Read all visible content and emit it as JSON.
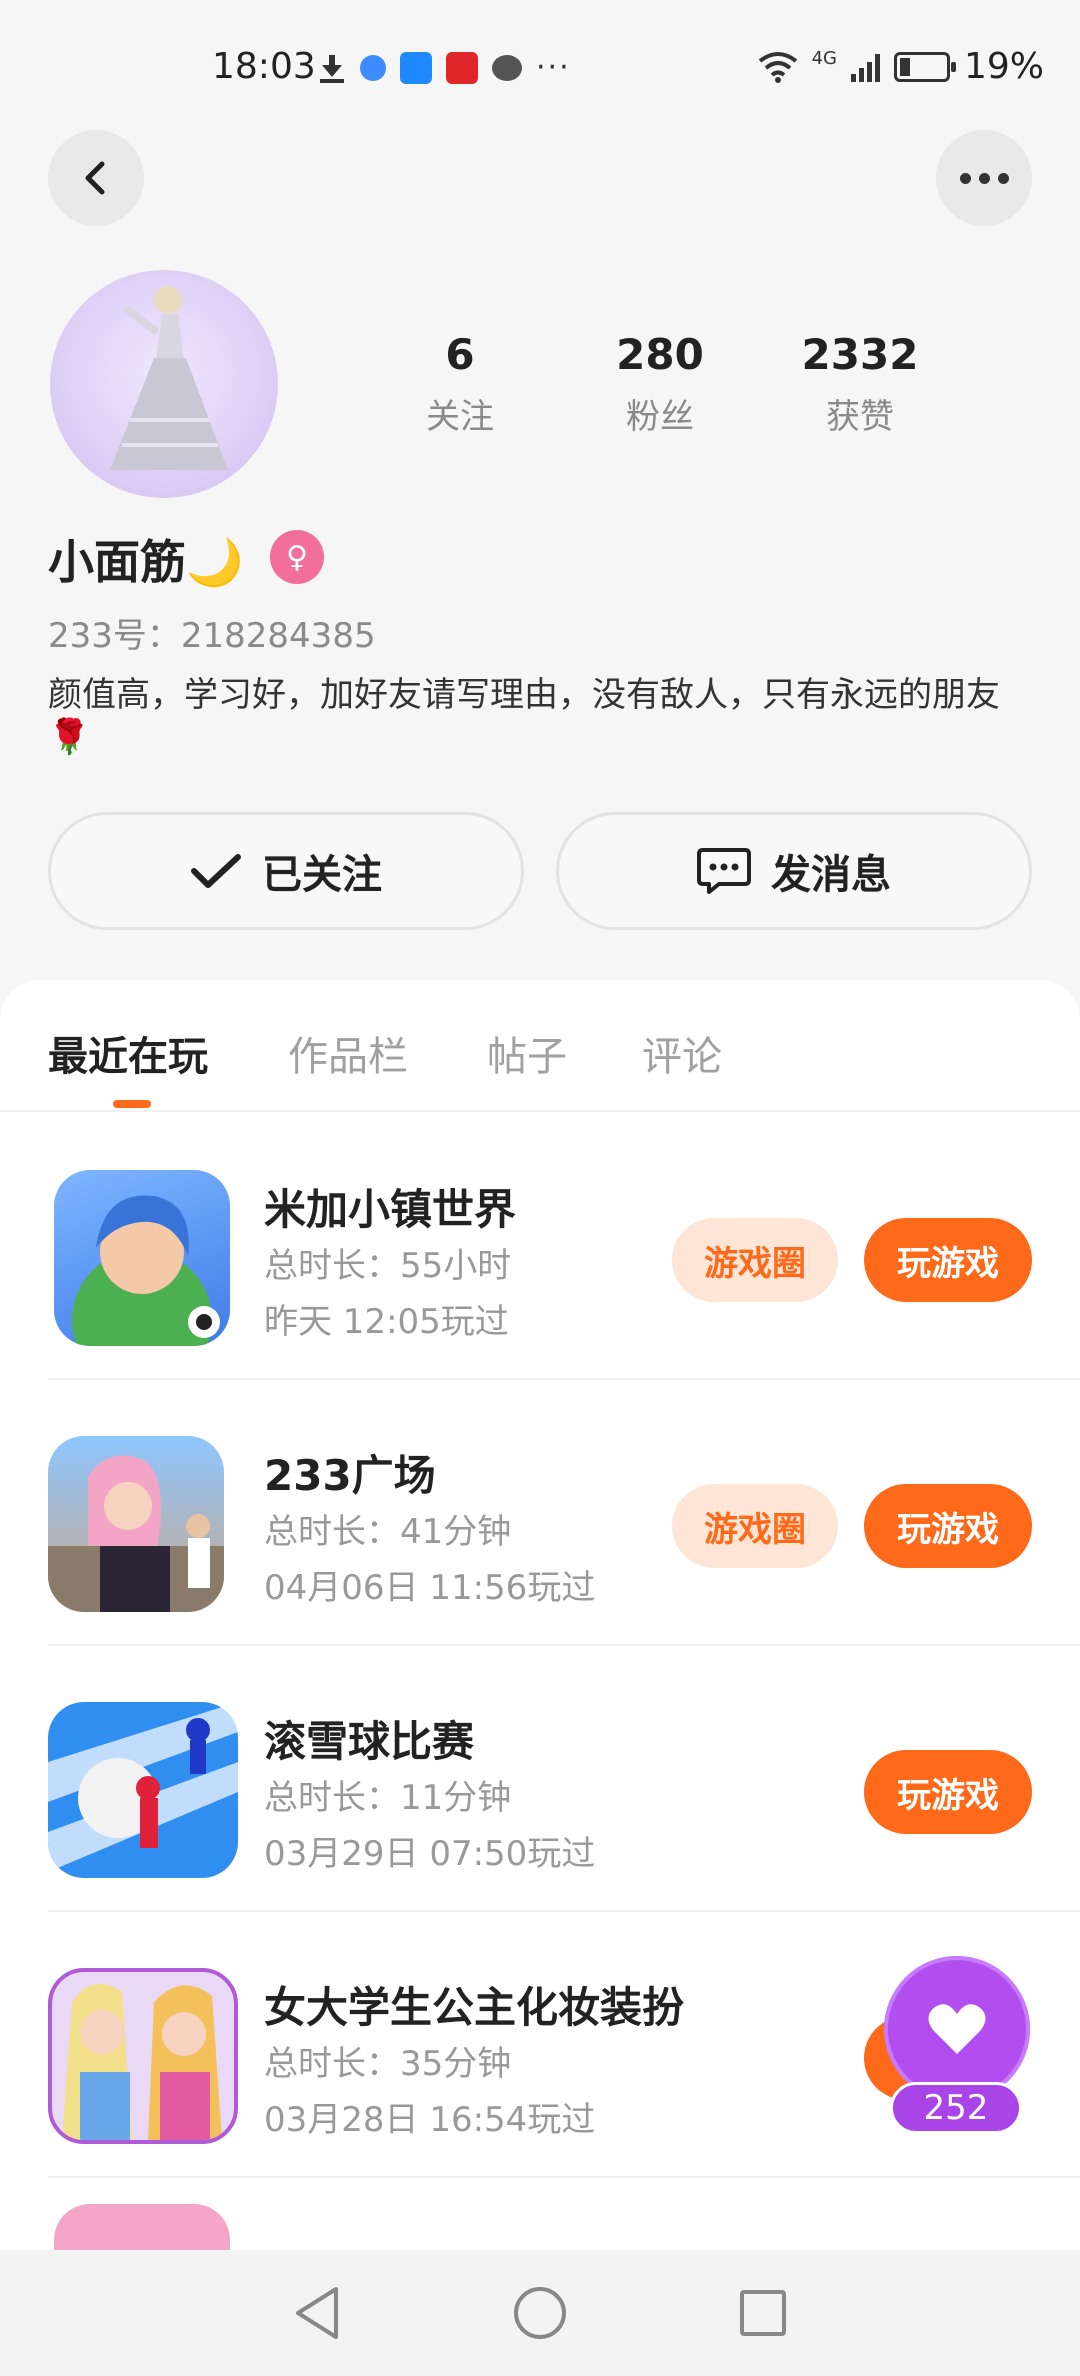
{
  "status_bar": {
    "time": "18:03",
    "more": "···",
    "network": "4G",
    "battery": "19%"
  },
  "profile": {
    "stats": [
      {
        "value": "6",
        "label": "关注"
      },
      {
        "value": "280",
        "label": "粉丝"
      },
      {
        "value": "2332",
        "label": "获赞"
      }
    ],
    "nickname": "小面筋🌙",
    "gender_symbol": "♀",
    "uid": "233号：218284385",
    "bio": "颜值高，学习好，加好友请写理由，没有敌人，只有永远的朋友🌹",
    "follow_label": "已关注",
    "message_label": "发消息"
  },
  "tabs": [
    "最近在玩",
    "作品栏",
    "帖子",
    "评论"
  ],
  "games": [
    {
      "title": "米加小镇世界",
      "duration": "总时长：55小时",
      "last_played": "昨天 12:05玩过",
      "circle_label": "游戏圈",
      "play_label": "玩游戏"
    },
    {
      "title": "233广场",
      "duration": "总时长：41分钟",
      "last_played": "04月06日 11:56玩过",
      "circle_label": "游戏圈",
      "play_label": "玩游戏"
    },
    {
      "title": "滚雪球比赛",
      "duration": "总时长：11分钟",
      "last_played": "03月29日 07:50玩过",
      "play_label": "玩游戏"
    },
    {
      "title": "女大学生公主化妆装扮",
      "duration": "总时长：35分钟",
      "last_played": "03月28日 16:54玩过"
    }
  ],
  "like_count": "252",
  "colors": {
    "accent": "#ff6a1a",
    "accent_light": "#ffe5d6",
    "like": "#b24ef0",
    "gender": "#f26f9b"
  }
}
